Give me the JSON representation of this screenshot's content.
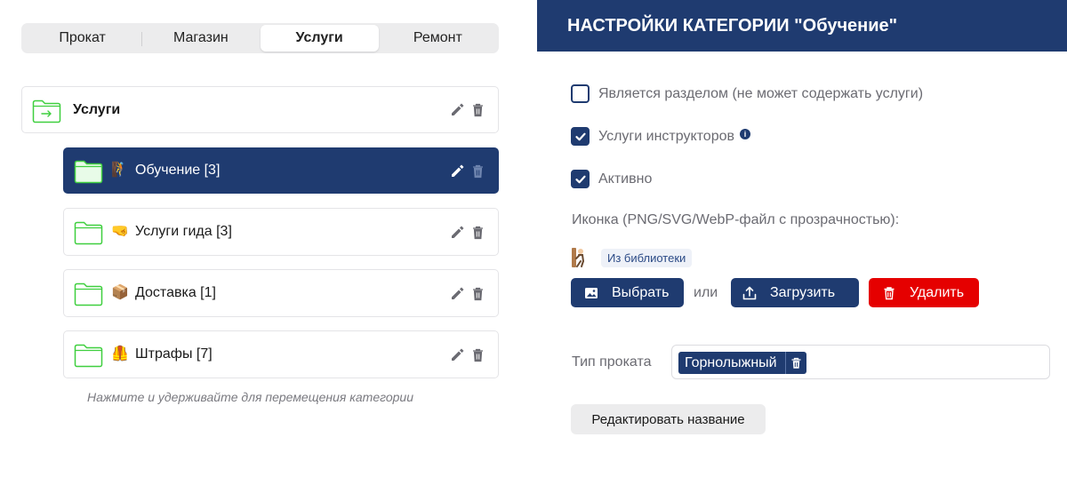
{
  "tabs": [
    {
      "label": "Прокат",
      "active": false
    },
    {
      "label": "Магазин",
      "active": false
    },
    {
      "label": "Услуги",
      "active": true
    },
    {
      "label": "Ремонт",
      "active": false
    }
  ],
  "root_category": {
    "label": "Услуги",
    "icon": "folder-arrow-icon"
  },
  "categories": [
    {
      "label": "Обучение [3]",
      "emoji": "🧗",
      "selected": true
    },
    {
      "label": "Услуги гида [3]",
      "emoji": "🤜",
      "selected": false
    },
    {
      "label": "Доставка [1]",
      "emoji": "📦",
      "selected": false
    },
    {
      "label": "Штрафы [7]",
      "emoji": "🦺",
      "selected": false
    }
  ],
  "hint": "Нажмите и удерживайте для перемещения категории",
  "settings": {
    "title": "НАСТРОЙКИ КАТЕГОРИИ \"Обучение\"",
    "checkboxes": [
      {
        "label": "Является разделом (не может содержать услуги)",
        "checked": false
      },
      {
        "label": "Услуги инструкторов",
        "checked": true,
        "info": "i"
      },
      {
        "label": "Активно",
        "checked": true
      }
    ],
    "icon_title": "Иконка (PNG/SVG/WebP-файл с прозрачностью):",
    "library_badge": "Из библиотеки",
    "select_button": "Выбрать",
    "or_text": "или",
    "upload_button": "Загрузить",
    "delete_button": "Удалить",
    "rent_type_label": "Тип проката",
    "rent_type_value": "Горнолыжный",
    "edit_name_button": "Редактировать название"
  },
  "colors": {
    "primary": "#1f3b70",
    "danger": "#e50000",
    "folder_green": "#3fcf3f"
  }
}
